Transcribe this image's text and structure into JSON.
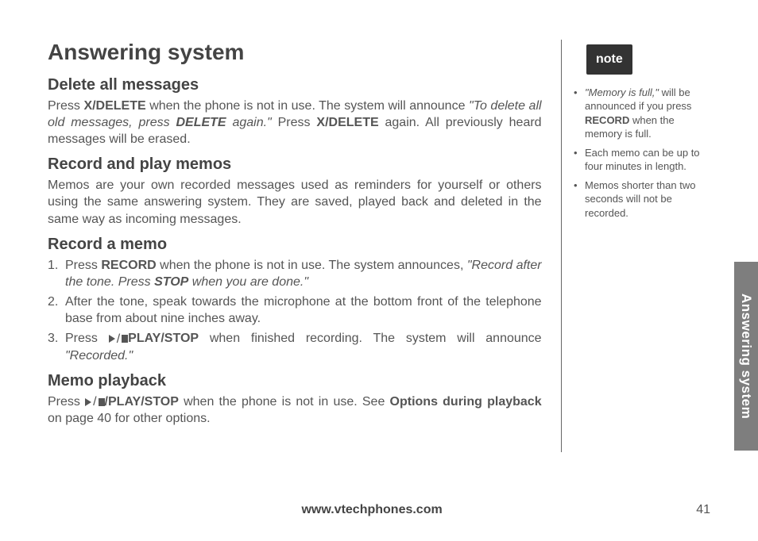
{
  "main": {
    "title": "Answering system",
    "sections": {
      "delete": {
        "heading": "Delete all messages",
        "p1_a": "Press ",
        "p1_key1": "X/DELETE",
        "p1_b": " when the phone is not in use. The system will announce ",
        "p1_quote_a": "\"To delete all old messages, press ",
        "p1_quote_key": "DELETE",
        "p1_quote_b": " again.\"",
        "p1_c": " Press ",
        "p1_key2": "X/DELETE",
        "p1_d": " again. All previously heard messages will be erased."
      },
      "intro": {
        "heading": "Record and play memos",
        "p1": "Memos are your own recorded messages used as reminders for yourself or others using the same answering system. They are saved, played back and deleted in the same way as incoming messages."
      },
      "record": {
        "heading": "Record a memo",
        "s1_num": "1.",
        "s1_a": "Press ",
        "s1_key": "RECORD",
        "s1_b": " when the phone is not in use. The system announces, ",
        "s1_quote_a": "\"Record after the tone. Press ",
        "s1_quote_key": "STOP",
        "s1_quote_b": " when you are done.\"",
        "s2_num": "2.",
        "s2": "After the tone, speak towards the microphone at the bottom front of the telephone base from about nine inches away.",
        "s3_num": "3.",
        "s3_a": "Press ",
        "s3_key": "PLAY/STOP",
        "s3_b": " when finished recording. The system will announce ",
        "s3_quote": "\"Recorded.\""
      },
      "playback": {
        "heading": "Memo playback",
        "p1_a": "Press ",
        "p1_key": "/PLAY/STOP",
        "p1_b": " when the phone is not in use. See ",
        "p1_ref": "Options during playback",
        "p1_c": " on page 40 for other options."
      }
    }
  },
  "sidebar": {
    "badge": "note",
    "items": {
      "n1_a": "\"Memory is full,\"",
      "n1_b": " will be announced if you press ",
      "n1_key": "RECORD",
      "n1_c": " when the memory is full.",
      "n2": "Each memo can be up to four minutes in length.",
      "n3": "Memos shorter than two seconds will not be recorded."
    }
  },
  "footer": {
    "url": "www.vtechphones.com",
    "page": "41"
  },
  "sidetab": "Answering system"
}
